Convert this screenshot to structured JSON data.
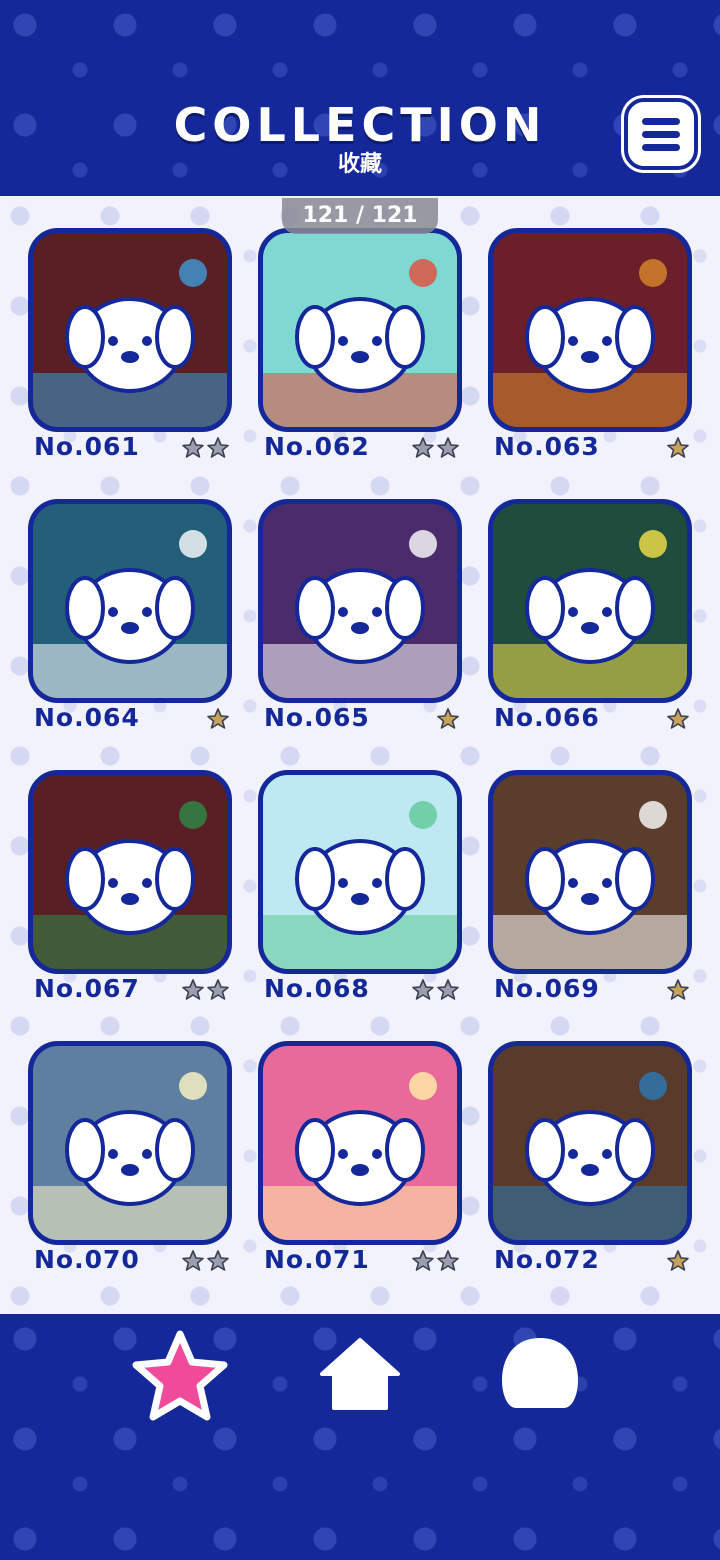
{
  "header": {
    "title": "COLLECTION",
    "subtitle": "收藏",
    "menu_icon": "hamburger-menu-icon"
  },
  "counter": "121 / 121",
  "cards": [
    {
      "number": "No.061",
      "stars": "two-gray",
      "palette": [
        "#5a1f24",
        "#3d9bd6"
      ]
    },
    {
      "number": "No.062",
      "stars": "two-gray",
      "palette": [
        "#7fd9d2",
        "#e64c3c"
      ]
    },
    {
      "number": "No.063",
      "stars": "one-gold",
      "palette": [
        "#6b1f2b",
        "#d98a2b"
      ]
    },
    {
      "number": "No.064",
      "stars": "one-gold",
      "palette": [
        "#235f7a",
        "#ffffff"
      ]
    },
    {
      "number": "No.065",
      "stars": "one-gold",
      "palette": [
        "#4a2b6b",
        "#ffffff"
      ]
    },
    {
      "number": "No.066",
      "stars": "one-gold",
      "palette": [
        "#1f4c3d",
        "#f5e24a"
      ]
    },
    {
      "number": "No.067",
      "stars": "two-gray",
      "palette": [
        "#5a1f24",
        "#2d8a4a"
      ]
    },
    {
      "number": "No.068",
      "stars": "two-gray",
      "palette": [
        "#bfe9f2",
        "#5ec997"
      ]
    },
    {
      "number": "No.069",
      "stars": "one-gold",
      "palette": [
        "#5a3e2b",
        "#ffffff"
      ]
    },
    {
      "number": "No.070",
      "stars": "two-gray",
      "palette": [
        "#5e7fa0",
        "#fff6c4"
      ]
    },
    {
      "number": "No.071",
      "stars": "two-gray",
      "palette": [
        "#e86a9a",
        "#fff1a8"
      ]
    },
    {
      "number": "No.072",
      "stars": "one-gold",
      "palette": [
        "#5a3a2b",
        "#2b7ab5"
      ]
    }
  ],
  "colors": {
    "navy": "#14289a",
    "gray_star": "#9aa0ad",
    "gold_star": "#c9a25a",
    "pink_star": "#f04a9a"
  },
  "nav": [
    {
      "icon": "star-icon",
      "active": true
    },
    {
      "icon": "home-icon",
      "active": false
    },
    {
      "icon": "dog-face-icon",
      "active": false
    }
  ]
}
